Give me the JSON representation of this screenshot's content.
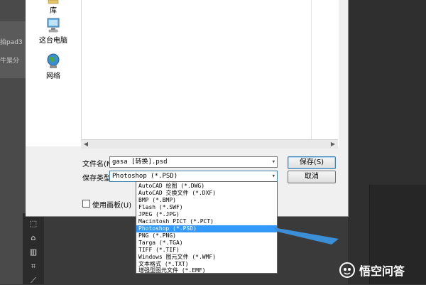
{
  "background": {
    "left_fragments": [
      "拍pad3",
      "牛是分"
    ]
  },
  "nav": {
    "items": [
      {
        "label": "库",
        "icon": "library-icon"
      },
      {
        "label": "这台电脑",
        "icon": "computer-icon"
      },
      {
        "label": "网络",
        "icon": "network-icon"
      }
    ]
  },
  "form": {
    "filename_label": "文件名(N):",
    "filename_value": "gasa [转换].psd",
    "filetype_label": "保存类型(T):",
    "filetype_value": "Photoshop (*.PSD)",
    "thumbnail_label": "使用画板(U)"
  },
  "buttons": {
    "save": "保存(S)",
    "cancel": "取消"
  },
  "dropdown": {
    "selected_index": 7,
    "options": [
      "AutoCAD 绘图 (*.DWG)",
      "AutoCAD 交换文件 (*.DXF)",
      "BMP (*.BMP)",
      "Flash (*.SWF)",
      "JPEG (*.JPG)",
      "Macintosh PICT (*.PCT)",
      "Photoshop (*.PSD)",
      "PNG (*.PNG)",
      "Targa (*.TGA)",
      "TIFF (*.TIF)",
      "Windows 图元文件 (*.WMF)",
      "文本格式 (*.TXT)",
      "增强型图元文件 (*.EMF)"
    ]
  },
  "watermark": {
    "text": "悟空问答",
    "icon": "wukong-logo-icon"
  },
  "colors": {
    "selection": "#3399ff",
    "arrow": "#3a8fd6"
  }
}
